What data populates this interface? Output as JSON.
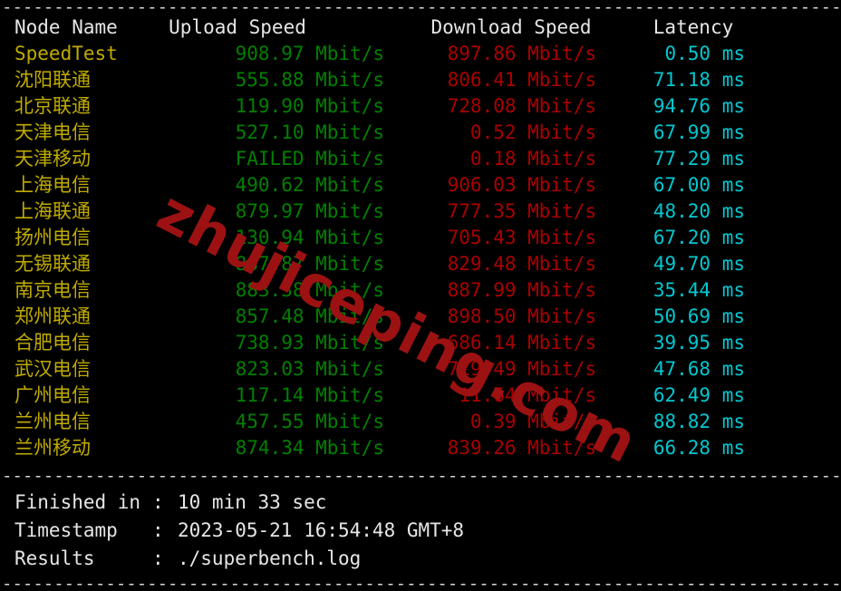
{
  "terminal": {
    "separator_top": "-------------------------------------------------------------------------------------------",
    "separator_mid": "-------------------------------------------------------------------------------------------",
    "separator_bottom": "-------------------------------------------------------------------------------------------",
    "watermark": "zhujiceping.com"
  },
  "colors": {
    "background": "#000000",
    "header_text": "#e6e6e6",
    "node_name": "#c0ab00",
    "upload": "#018000",
    "download": "#ab0000",
    "latency": "#02c8d2",
    "watermark": "#9c1212"
  },
  "table": {
    "headers": {
      "node": "Node Name",
      "upload": "Upload Speed",
      "download": "Download Speed",
      "latency": "Latency"
    },
    "rows": [
      {
        "node": "SpeedTest",
        "upload": "908.97 Mbit/s",
        "download": "897.86 Mbit/s",
        "latency": "0.50 ms"
      },
      {
        "node": "沈阳联通",
        "upload": "555.88 Mbit/s",
        "download": "806.41 Mbit/s",
        "latency": "71.18 ms"
      },
      {
        "node": "北京联通",
        "upload": "119.90 Mbit/s",
        "download": "728.08 Mbit/s",
        "latency": "94.76 ms"
      },
      {
        "node": "天津电信",
        "upload": "527.10 Mbit/s",
        "download": "0.52 Mbit/s",
        "latency": "67.99 ms"
      },
      {
        "node": "天津移动",
        "upload": "FAILED Mbit/s",
        "download": "0.18 Mbit/s",
        "latency": "77.29 ms"
      },
      {
        "node": "上海电信",
        "upload": "490.62 Mbit/s",
        "download": "906.03 Mbit/s",
        "latency": "67.00 ms"
      },
      {
        "node": "上海联通",
        "upload": "879.97 Mbit/s",
        "download": "777.35 Mbit/s",
        "latency": "48.20 ms"
      },
      {
        "node": "扬州电信",
        "upload": "130.94 Mbit/s",
        "download": "705.43 Mbit/s",
        "latency": "67.20 ms"
      },
      {
        "node": "无锡联通",
        "upload": "867.87 Mbit/s",
        "download": "829.48 Mbit/s",
        "latency": "49.70 ms"
      },
      {
        "node": "南京电信",
        "upload": "883.38 Mbit/s",
        "download": "887.99 Mbit/s",
        "latency": "35.44 ms"
      },
      {
        "node": "郑州联通",
        "upload": "857.48 Mbit/s",
        "download": "898.50 Mbit/s",
        "latency": "50.69 ms"
      },
      {
        "node": "合肥电信",
        "upload": "738.93 Mbit/s",
        "download": "686.14 Mbit/s",
        "latency": "39.95 ms"
      },
      {
        "node": "武汉电信",
        "upload": "823.03 Mbit/s",
        "download": "719.49 Mbit/s",
        "latency": "47.68 ms"
      },
      {
        "node": "广州电信",
        "upload": "117.14 Mbit/s",
        "download": "11.64 Mbit/s",
        "latency": "62.49 ms"
      },
      {
        "node": "兰州电信",
        "upload": "457.55 Mbit/s",
        "download": "0.39 Mbit/s",
        "latency": "88.82 ms"
      },
      {
        "node": "兰州移动",
        "upload": "874.34 Mbit/s",
        "download": "839.26 Mbit/s",
        "latency": "66.28 ms"
      }
    ]
  },
  "summary": {
    "finished_label": "Finished in",
    "finished_value": "10 min 33 sec",
    "timestamp_label": "Timestamp",
    "timestamp_value": "2023-05-21 16:54:48 GMT+8",
    "results_label": "Results",
    "results_value": "./superbench.log",
    "colon": ":"
  }
}
